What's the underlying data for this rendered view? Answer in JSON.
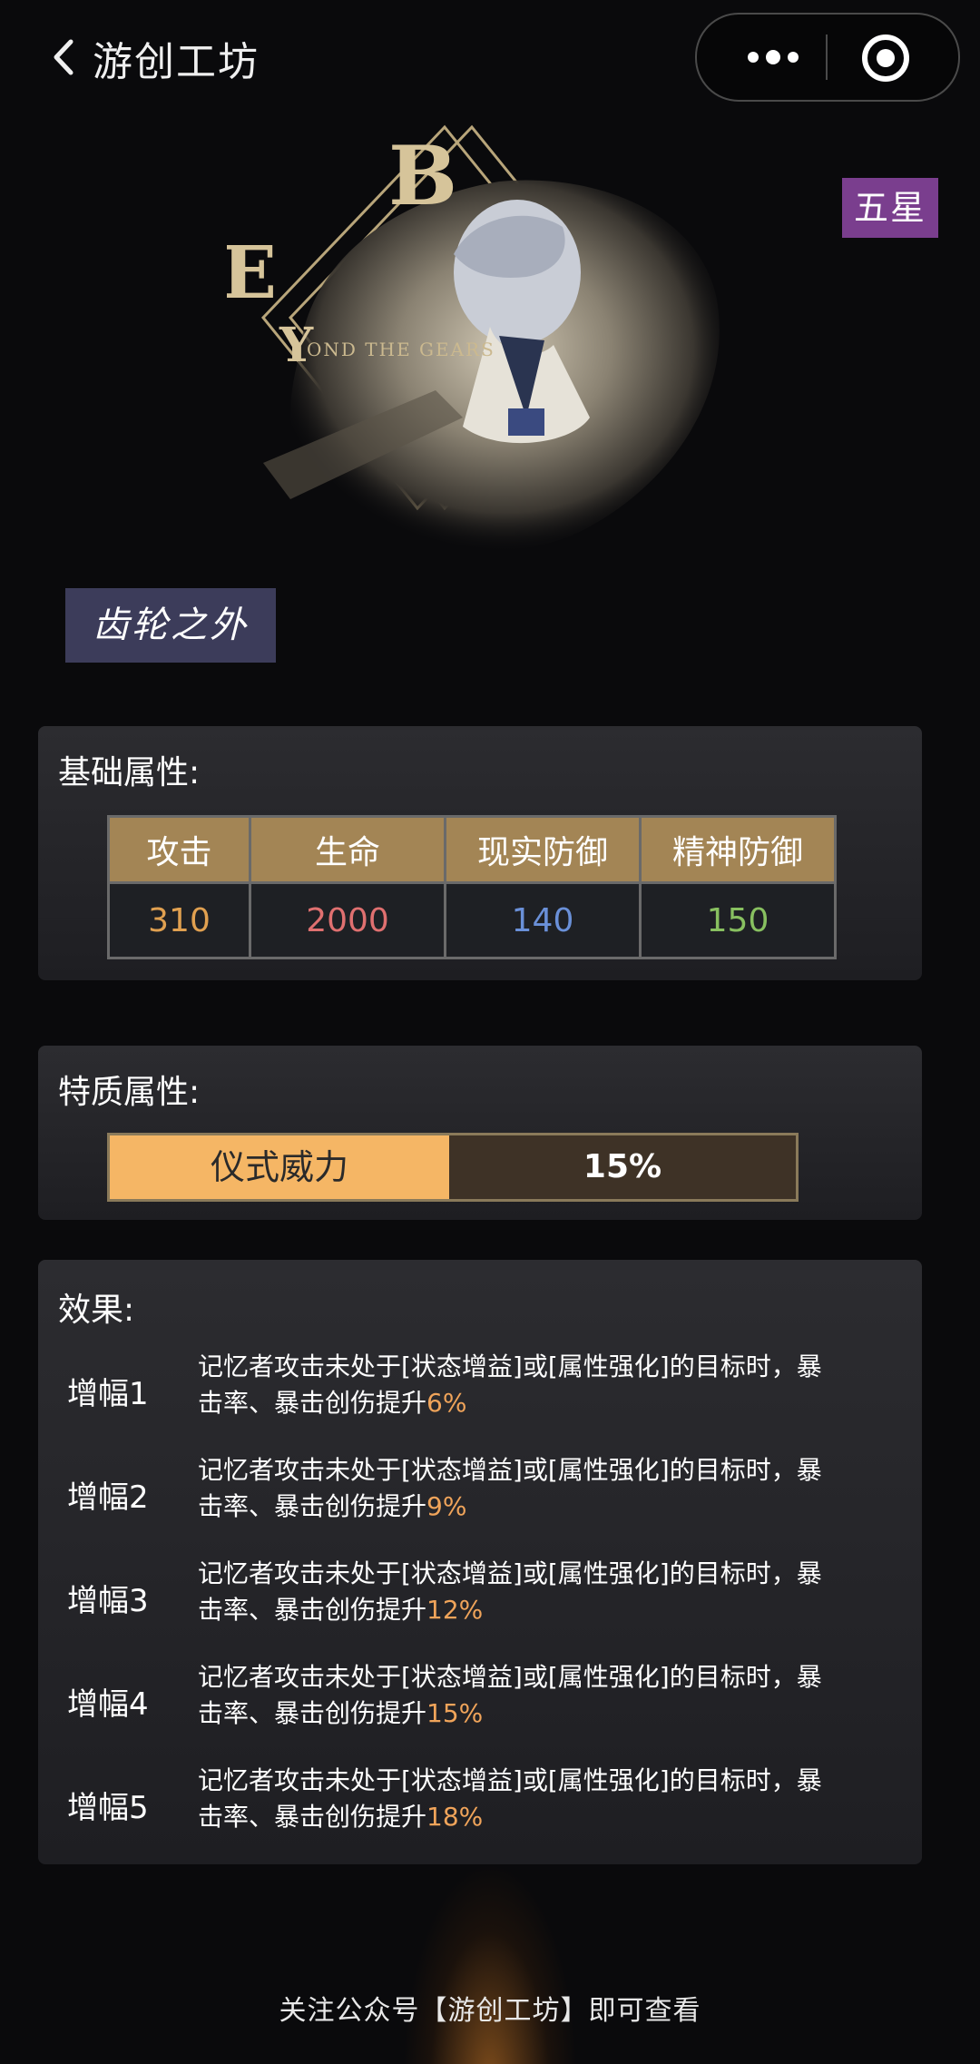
{
  "header": {
    "title": "游创工坊"
  },
  "card": {
    "rarity_badge": "五星",
    "name": "齿轮之外",
    "art_letters": [
      "B",
      "E",
      "Y"
    ],
    "art_caption": "OND THE GEARS"
  },
  "base_stats": {
    "title": "基础属性:",
    "columns": [
      {
        "label": "攻击",
        "value": "310",
        "color": "#e0a050"
      },
      {
        "label": "生命",
        "value": "2000",
        "color": "#e07070"
      },
      {
        "label": "现实防御",
        "value": "140",
        "color": "#6a90d8"
      },
      {
        "label": "精神防御",
        "value": "150",
        "color": "#88c060"
      }
    ]
  },
  "trait": {
    "title": "特质属性:",
    "name": "仪式威力",
    "value": "15%"
  },
  "effects": {
    "title": "效果:",
    "items": [
      {
        "label": "增幅1",
        "text_line1": "记忆者攻击未处于[状态增益]或[属性强化]的目标时，暴",
        "text_line2": "击率、暴击创伤提升",
        "value": "6%"
      },
      {
        "label": "增幅2",
        "text_line1": "记忆者攻击未处于[状态增益]或[属性强化]的目标时，暴",
        "text_line2": "击率、暴击创伤提升",
        "value": "9%"
      },
      {
        "label": "增幅3",
        "text_line1": "记忆者攻击未处于[状态增益]或[属性强化]的目标时，暴",
        "text_line2": "击率、暴击创伤提升",
        "value": "12%"
      },
      {
        "label": "增幅4",
        "text_line1": "记忆者攻击未处于[状态增益]或[属性强化]的目标时，暴",
        "text_line2": "击率、暴击创伤提升",
        "value": "15%"
      },
      {
        "label": "增幅5",
        "text_line1": "记忆者攻击未处于[状态增益]或[属性强化]的目标时，暴",
        "text_line2": "击率、暴击创伤提升",
        "value": "18%"
      }
    ]
  },
  "footer": {
    "text": "关注公众号【游创工坊】即可查看"
  },
  "icons": [
    "back-arrow-icon",
    "more-dots-icon",
    "target-circle-icon"
  ],
  "colors": {
    "accent_gold": "#a38555",
    "trait_orange": "#f5b665",
    "highlight": "#f0a45a",
    "rarity_purple": "#7a3e8e"
  }
}
